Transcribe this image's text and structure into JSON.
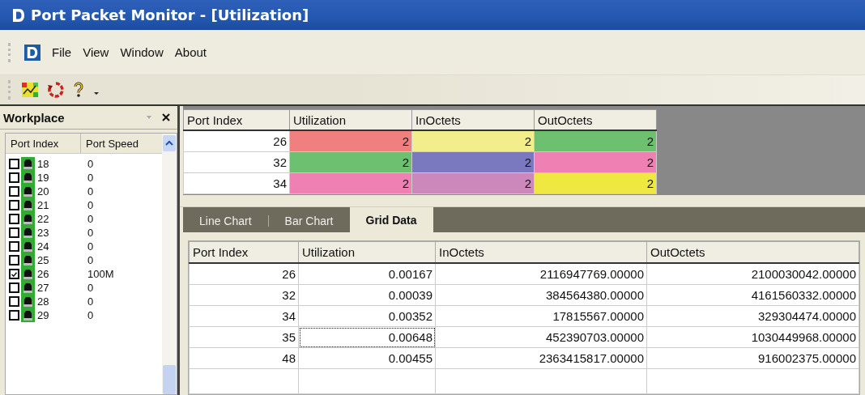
{
  "window": {
    "title": "Port Packet Monitor - [Utilization]"
  },
  "menu": [
    "File",
    "View",
    "Window",
    "About"
  ],
  "workplace": {
    "title": "Workplace",
    "columns": [
      "Port Index",
      "Port Speed"
    ],
    "items": [
      {
        "port": "18",
        "speed": "0",
        "checked": false
      },
      {
        "port": "19",
        "speed": "0",
        "checked": false
      },
      {
        "port": "20",
        "speed": "0",
        "checked": false
      },
      {
        "port": "21",
        "speed": "0",
        "checked": false
      },
      {
        "port": "22",
        "speed": "0",
        "checked": false
      },
      {
        "port": "23",
        "speed": "0",
        "checked": false
      },
      {
        "port": "24",
        "speed": "0",
        "checked": false
      },
      {
        "port": "25",
        "speed": "0",
        "checked": false
      },
      {
        "port": "26",
        "speed": "100M",
        "checked": true
      },
      {
        "port": "27",
        "speed": "0",
        "checked": false
      },
      {
        "port": "28",
        "speed": "0",
        "checked": false
      },
      {
        "port": "29",
        "speed": "0",
        "checked": false
      }
    ]
  },
  "legend_table": {
    "columns": [
      "Port Index",
      "Utilization",
      "InOctets",
      "OutOctets"
    ],
    "rows": [
      {
        "cells": [
          {
            "value": "26"
          },
          {
            "value": "2",
            "color": "#f08080"
          },
          {
            "value": "2",
            "color": "#f2ee8c"
          },
          {
            "value": "2",
            "color": "#6cc070"
          }
        ]
      },
      {
        "cells": [
          {
            "value": "32"
          },
          {
            "value": "2",
            "color": "#6cc070"
          },
          {
            "value": "2",
            "color": "#7a78bf"
          },
          {
            "value": "2",
            "color": "#ee80b4"
          }
        ]
      },
      {
        "cells": [
          {
            "value": "34"
          },
          {
            "value": "2",
            "color": "#ee80b4"
          },
          {
            "value": "2",
            "color": "#cc88bb"
          },
          {
            "value": "2",
            "color": "#eee840"
          }
        ]
      }
    ]
  },
  "tabs": [
    {
      "label": "Line Chart",
      "selected": false
    },
    {
      "label": "Bar Chart",
      "selected": false
    },
    {
      "label": "Grid Data",
      "selected": true
    }
  ],
  "grid": {
    "columns": [
      "Port Index",
      "Utilization",
      "InOctets",
      "OutOctets"
    ],
    "rows": [
      {
        "cells": [
          "26",
          "0.00167",
          "2116947769.00000",
          "2100030042.00000"
        ],
        "focused": false
      },
      {
        "cells": [
          "32",
          "0.00039",
          "384564380.00000",
          "4161560332.00000"
        ],
        "focused": false
      },
      {
        "cells": [
          "34",
          "0.00352",
          "17815567.00000",
          "329304474.00000"
        ],
        "focused": false
      },
      {
        "cells": [
          "35",
          "0.00648",
          "452390703.00000",
          "1030449968.00000"
        ],
        "focused": true
      },
      {
        "cells": [
          "48",
          "0.00455",
          "2363415817.00000",
          "916002375.00000"
        ],
        "focused": false
      }
    ]
  }
}
